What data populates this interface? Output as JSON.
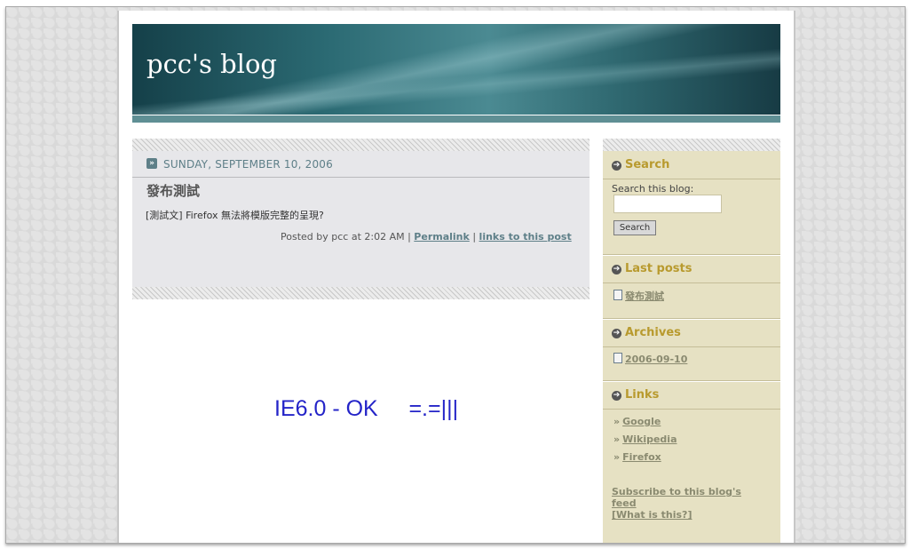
{
  "blog": {
    "title": "pcc's blog"
  },
  "post": {
    "date": "SUNDAY, SEPTEMBER 10, 2006",
    "title": "發布測試",
    "body": "[測試文] Firefox 無法將模版完整的呈現?",
    "footer_prefix": "Posted by pcc at 2:02 AM |",
    "permalink": "Permalink",
    "separator": "|",
    "links_to_post": "links to this post"
  },
  "overlay": {
    "text": "IE6.0 - OK     =.=|||"
  },
  "sidebar": {
    "search": {
      "heading": "Search",
      "label": "Search this blog:",
      "input_value": "",
      "button": "Search"
    },
    "last_posts": {
      "heading": "Last posts",
      "items": [
        "發布測試"
      ]
    },
    "archives": {
      "heading": "Archives",
      "items": [
        "2006-09-10"
      ]
    },
    "links": {
      "heading": "Links",
      "items": [
        "Google",
        "Wikipedia",
        "Firefox"
      ]
    },
    "subscribe": {
      "text": "Subscribe to this blog's feed",
      "what": "[What is this?]"
    }
  },
  "icons": {
    "section_arrow": "arrow-right-icon",
    "date_arrow": "double-chevron-icon",
    "post_item": "document-icon",
    "link_bullet": "raquo"
  }
}
